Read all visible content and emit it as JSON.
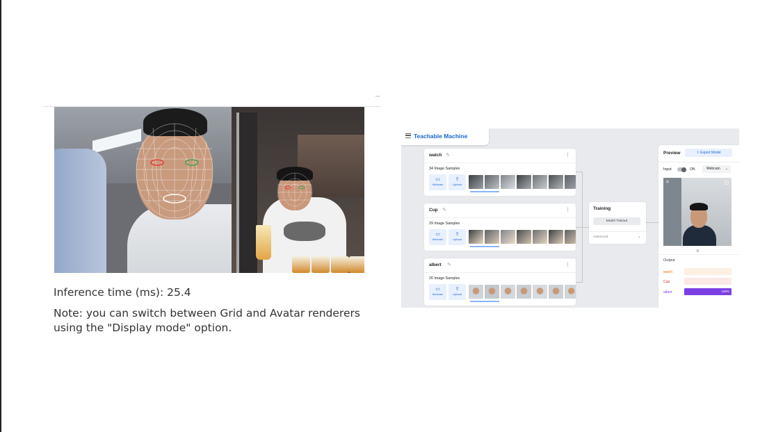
{
  "inference": "Inference time (ms): 25.4",
  "note": "Note: you can switch between Grid and Avatar renderers using the \"Display mode\" option.",
  "tm": {
    "title": "Teachable Machine",
    "classes": [
      {
        "name": "watch",
        "samples": "34 Image Samples",
        "webcam": "Webcam",
        "upload": "Upload"
      },
      {
        "name": "Cup",
        "samples": "29 Image Samples",
        "webcam": "Webcam",
        "upload": "Upload"
      },
      {
        "name": "albert",
        "samples": "26 Image Samples",
        "webcam": "Webcam",
        "upload": "Upload"
      }
    ],
    "training": {
      "title": "Training",
      "status": "Model Trained",
      "advanced": "Advanced"
    },
    "preview": {
      "title": "Preview",
      "export": "Export Model",
      "input_label": "Input",
      "toggle_state": "ON",
      "source": "Webcam",
      "output_label": "Output",
      "results": [
        {
          "label": "watch",
          "color": "#e8710a",
          "bg": "#feefe3",
          "value": 0,
          "text": ""
        },
        {
          "label": "Cup",
          "color": "#d93025",
          "bg": "#fce8e6",
          "value": 0,
          "text": ""
        },
        {
          "label": "albert",
          "color": "#7b3fe4",
          "bg": "#ede7f6",
          "value": 1,
          "text": "100%"
        }
      ]
    }
  }
}
